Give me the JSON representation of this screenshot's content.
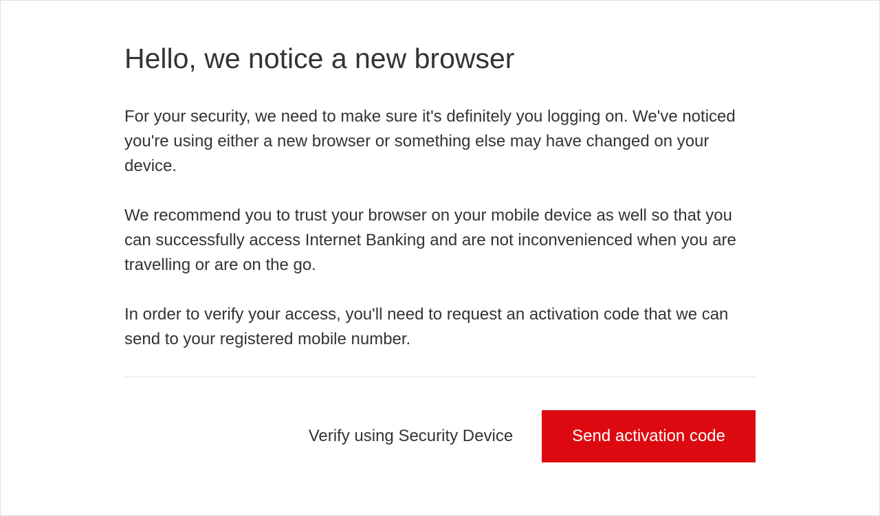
{
  "title": "Hello, we notice a new browser",
  "paragraphs": {
    "p1": "For your security, we need to make sure it's definitely you logging on. We've noticed you're using either a new browser or something else may have changed on your device.",
    "p2": "We recommend you to trust your browser on your mobile device as well so that you can successfully access Internet Banking and are not inconvenienced when you are travelling or are on the go.",
    "p3": "In order to verify your access, you'll need to request an activation code that we can send to your registered mobile number."
  },
  "actions": {
    "secondary_label": "Verify using Security Device",
    "primary_label": "Send activation code"
  }
}
